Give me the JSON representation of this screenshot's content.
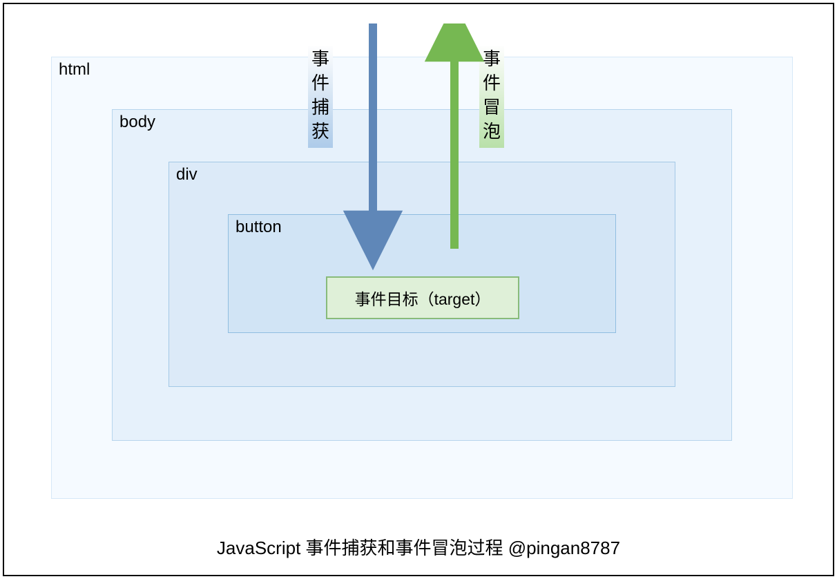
{
  "boxes": {
    "html": "html",
    "body": "body",
    "div": "div",
    "button": "button"
  },
  "target": "事件目标（target）",
  "labels": {
    "capture": "事件捕获",
    "bubble": "事件冒泡"
  },
  "caption": "JavaScript 事件捕获和事件冒泡过程  @pingan8787",
  "colors": {
    "arrow_capture": "#5f87b8",
    "arrow_bubble": "#76b852"
  }
}
